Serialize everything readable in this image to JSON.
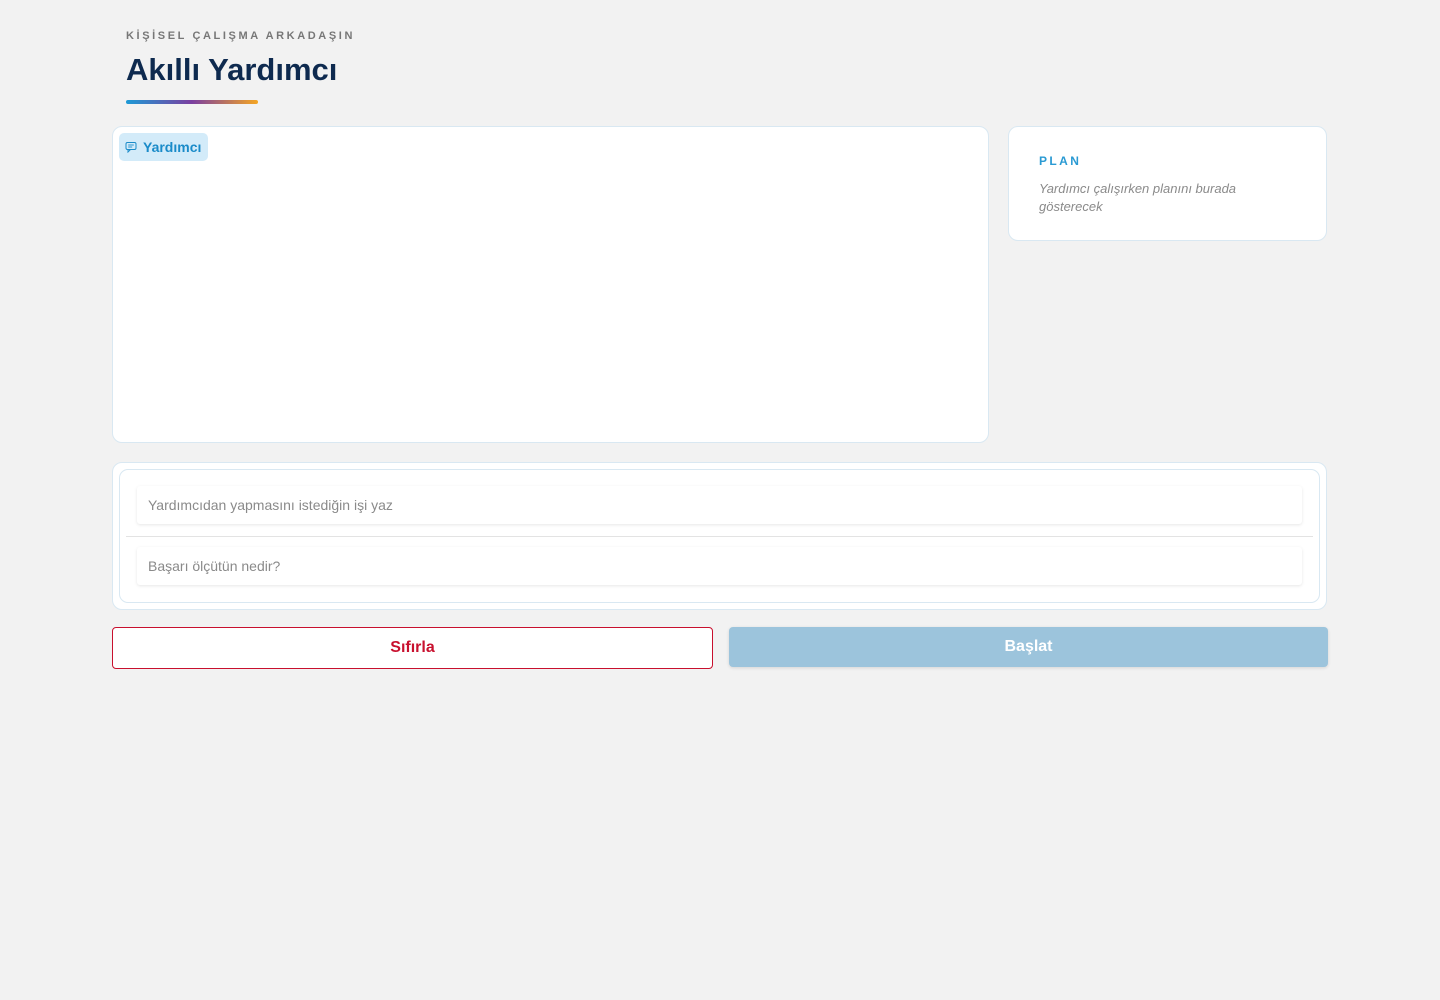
{
  "header": {
    "eyebrow": "KİŞİSEL ÇALIŞMA ARKADAŞIN",
    "title": "Akıllı Yardımcı"
  },
  "chat": {
    "tag_label": "Yardımcı",
    "tag_icon": "chat-bubble-icon"
  },
  "plan": {
    "title": "PLAN",
    "hint": "Yardımcı çalışırken planını burada gösterecek"
  },
  "form": {
    "task_placeholder": "Yardımcıdan yapmasını istediğin işi yaz",
    "task_value": "",
    "criteria_placeholder": "Başarı ölçütün nedir?",
    "criteria_value": ""
  },
  "actions": {
    "reset_label": "Sıfırla",
    "start_label": "Başlat"
  },
  "colors": {
    "accent": "#2a9ad3",
    "title": "#0e2a4f",
    "danger": "#c8102e",
    "start_disabled": "#9cc4dc"
  }
}
